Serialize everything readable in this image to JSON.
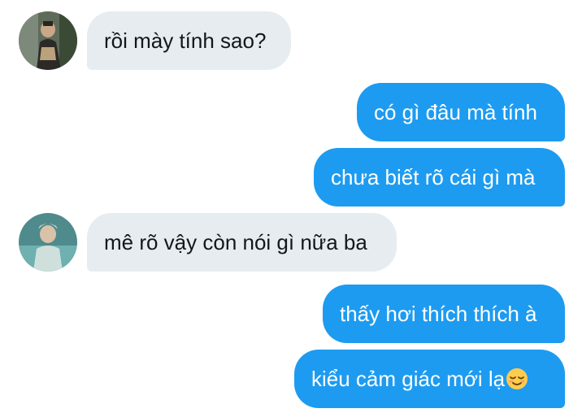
{
  "messages": [
    {
      "side": "incoming",
      "avatar": "avatar-1",
      "text": "rồi mày tính sao?"
    },
    {
      "side": "outgoing",
      "text": "có gì đâu mà tính"
    },
    {
      "side": "outgoing",
      "text": "chưa biết rõ cái gì mà"
    },
    {
      "side": "incoming",
      "avatar": "avatar-2",
      "text": "mê rõ vậy còn nói gì nữa ba"
    },
    {
      "side": "outgoing",
      "text": "thấy hơi thích thích à"
    },
    {
      "side": "outgoing",
      "text": "kiểu cảm giác mới lạ",
      "emoji": "relieved-face-icon"
    }
  ],
  "colors": {
    "incoming_bubble": "#e6ecf0",
    "outgoing_bubble": "#1d9bf0",
    "incoming_text": "#14171a",
    "outgoing_text": "#ffffff"
  }
}
